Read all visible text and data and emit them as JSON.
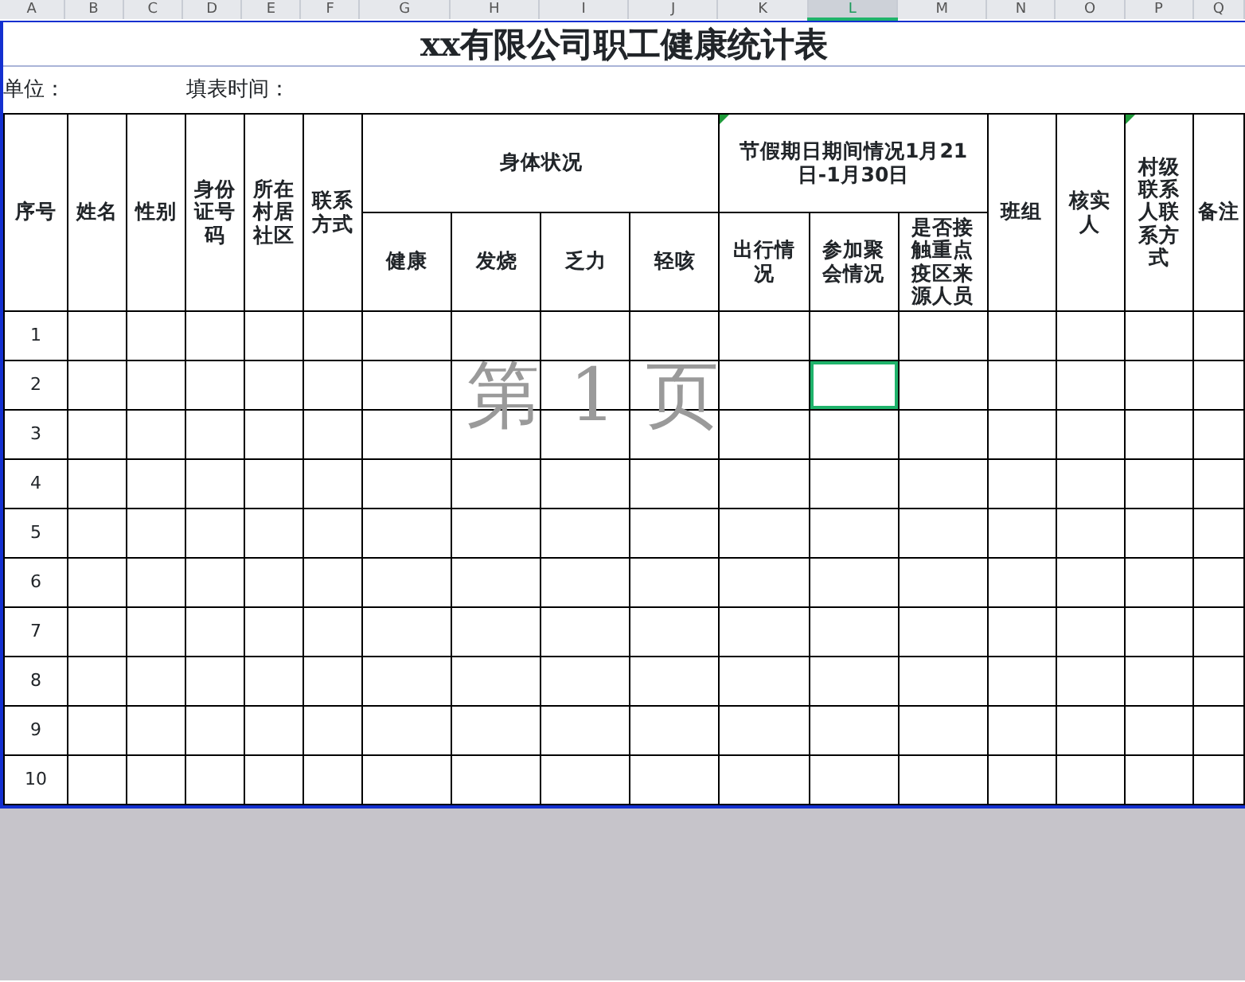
{
  "column_letters": [
    {
      "label": "A",
      "selected": false
    },
    {
      "label": "B",
      "selected": false
    },
    {
      "label": "C",
      "selected": false
    },
    {
      "label": "D",
      "selected": false
    },
    {
      "label": "E",
      "selected": false
    },
    {
      "label": "F",
      "selected": false
    },
    {
      "label": "G",
      "selected": false
    },
    {
      "label": "H",
      "selected": false
    },
    {
      "label": "I",
      "selected": false
    },
    {
      "label": "J",
      "selected": false
    },
    {
      "label": "K",
      "selected": false
    },
    {
      "label": "L",
      "selected": true
    },
    {
      "label": "M",
      "selected": false
    },
    {
      "label": "N",
      "selected": false
    },
    {
      "label": "O",
      "selected": false
    },
    {
      "label": "P",
      "selected": false
    },
    {
      "label": "Q",
      "selected": false
    }
  ],
  "title": "xx有限公司职工健康统计表",
  "info": [
    {
      "label": "单位："
    },
    {
      "label": "填表时间："
    }
  ],
  "header_columns": [
    {
      "label": "序号",
      "comment": false
    },
    {
      "label": "姓名",
      "comment": false
    },
    {
      "label": "性别",
      "comment": false
    },
    {
      "label": "身份证号码",
      "comment": false
    },
    {
      "label": "所在村居社区",
      "comment": false
    },
    {
      "label": "联系方式",
      "comment": false
    },
    {
      "label": "身体状况",
      "comment": false,
      "children": [
        {
          "label": "健康"
        },
        {
          "label": "发烧"
        },
        {
          "label": "乏力"
        },
        {
          "label": "轻咳"
        }
      ]
    },
    {
      "label": "节假期日期间情况1月21 日-1月30日",
      "comment": true,
      "children": [
        {
          "label": "出行情况"
        },
        {
          "label": "参加聚会情况"
        },
        {
          "label": "是否接触重点疫区来源人员"
        }
      ]
    },
    {
      "label": "班组",
      "comment": false
    },
    {
      "label": "核实人",
      "comment": false
    },
    {
      "label": "村级联系人联系方式",
      "comment": true
    },
    {
      "label": "备注",
      "comment": false
    }
  ],
  "rows": [
    {
      "number": "1",
      "selected": false
    },
    {
      "number": "2",
      "selected": true
    },
    {
      "number": "3",
      "selected": false
    },
    {
      "number": "4",
      "selected": false
    },
    {
      "number": "5",
      "selected": false
    },
    {
      "number": "6",
      "selected": false
    },
    {
      "number": "7",
      "selected": false
    },
    {
      "number": "8",
      "selected": false
    },
    {
      "number": "9",
      "selected": false
    },
    {
      "number": "10",
      "selected": false
    }
  ],
  "page_label": "第 1 页"
}
